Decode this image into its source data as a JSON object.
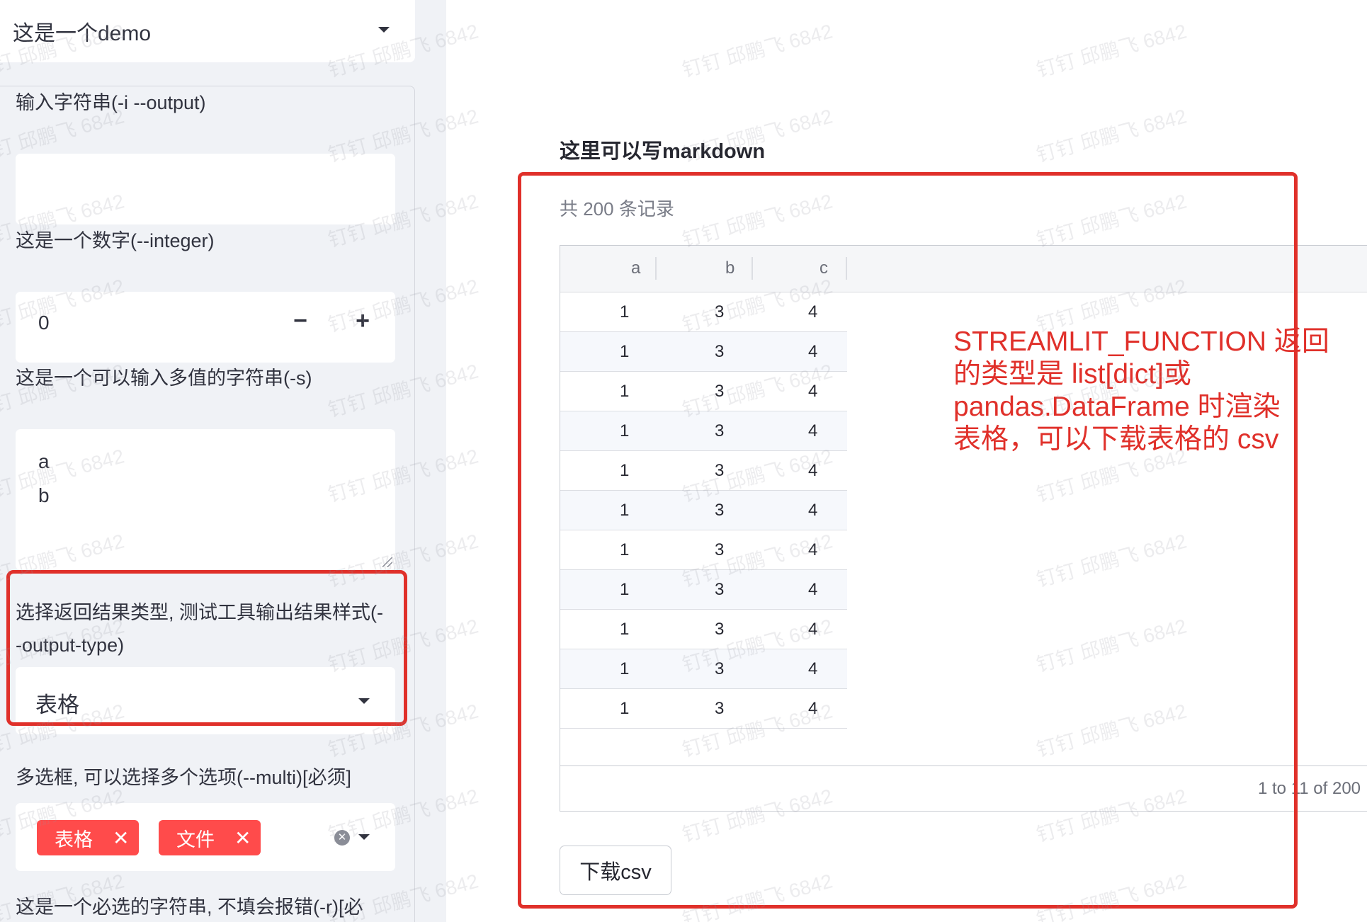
{
  "sidebar": {
    "top_select": {
      "value": "这是一个demo"
    },
    "fields": {
      "string_input": {
        "label": "输入字符串(-i --output)",
        "value": ""
      },
      "number_input": {
        "label": "这是一个数字(--integer)",
        "value": "0",
        "minus": "−",
        "plus": "+"
      },
      "multi_string": {
        "label": "这是一个可以输入多值的字符串(-s)",
        "lines": [
          "a",
          "b"
        ]
      },
      "output_type": {
        "label_line1": "选择返回结果类型, 测试工具输出结果样式(-",
        "label_line2": "-output-type)",
        "value": "表格"
      },
      "multi_select": {
        "label": "多选框, 可以选择多个选项(--multi)[必须]",
        "tags": [
          "表格",
          "文件"
        ],
        "tag_remove": "✕",
        "clear": "✕"
      },
      "required_string": {
        "label": "这是一个必选的字符串, 不填会报错(-r)[必"
      }
    }
  },
  "main": {
    "title": "这里可以写markdown",
    "record_count": "共 200 条记录",
    "table": {
      "columns": [
        "a",
        "b",
        "c"
      ],
      "rows": [
        [
          "1",
          "3",
          "4"
        ],
        [
          "1",
          "3",
          "4"
        ],
        [
          "1",
          "3",
          "4"
        ],
        [
          "1",
          "3",
          "4"
        ],
        [
          "1",
          "3",
          "4"
        ],
        [
          "1",
          "3",
          "4"
        ],
        [
          "1",
          "3",
          "4"
        ],
        [
          "1",
          "3",
          "4"
        ],
        [
          "1",
          "3",
          "4"
        ],
        [
          "1",
          "3",
          "4"
        ],
        [
          "1",
          "3",
          "4"
        ]
      ],
      "pager": "1 to 11 of 200"
    },
    "download_button": "下载csv"
  },
  "annotation": {
    "lines": [
      "STREAMLIT_FUNCTION 返回",
      "的类型是 list[dict]或",
      "pandas.DataFrame 时渲染",
      "表格，可以下载表格的 csv"
    ]
  },
  "watermark": "钉钉 邱鹏飞 6842",
  "colors": {
    "accent": "#ff4b4b",
    "annotation": "#e0302a",
    "sidebar_bg": "#f0f2f6"
  }
}
